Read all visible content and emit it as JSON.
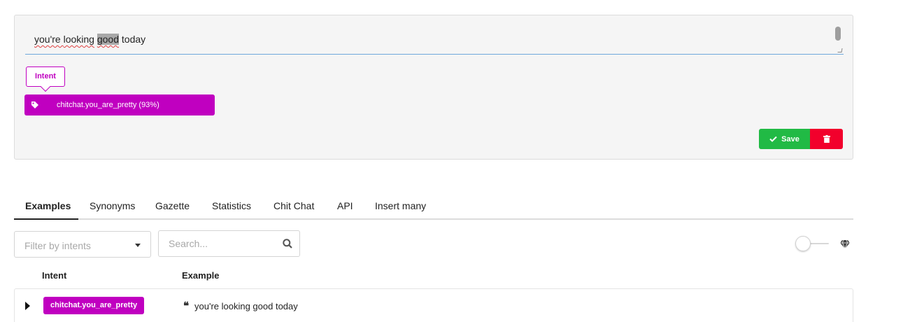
{
  "editor": {
    "text_before": "you're ",
    "text_word2": "looking",
    "text_space": " ",
    "text_highlight": "good",
    "text_after": " today",
    "tooltip_label": "Intent",
    "intent_bar_label": "chitchat.you_are_pretty (93%)",
    "tag_icon": "tag-icon",
    "save_label": "Save",
    "save_icon": "check-icon",
    "delete_icon": "trash-icon"
  },
  "tabs": [
    {
      "label": "Examples",
      "active": true
    },
    {
      "label": "Synonyms"
    },
    {
      "label": "Gazette"
    },
    {
      "label": "Statistics"
    },
    {
      "label": "Chit Chat"
    },
    {
      "label": "API"
    },
    {
      "label": "Insert many"
    }
  ],
  "filter": {
    "placeholder": "Filter by intents"
  },
  "search": {
    "placeholder": "Search...",
    "icon": "search-icon"
  },
  "toolbar": {
    "toggle_on": false,
    "diamond_icon": "diamond-icon"
  },
  "table": {
    "headers": [
      "Intent",
      "Example"
    ],
    "rows": [
      {
        "intent": "chitchat.you_are_pretty",
        "example": "you're looking good today"
      }
    ]
  },
  "colors": {
    "intent": "#c000c0",
    "save": "#21ba45",
    "delete": "#f2002c"
  }
}
